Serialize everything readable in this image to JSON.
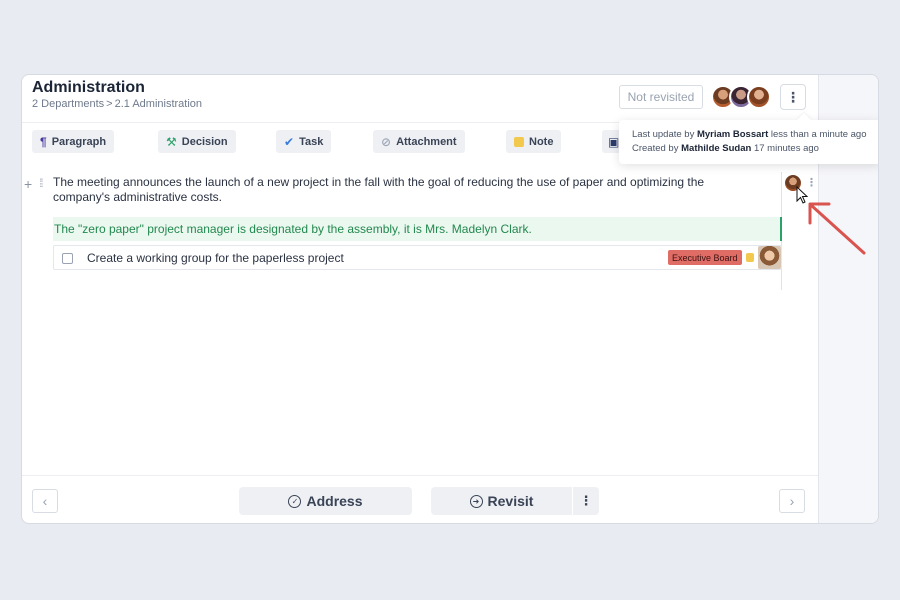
{
  "header": {
    "title": "Administration",
    "breadcrumb": {
      "part1": "2 Departments",
      "separator": ">",
      "part2": "2.1 Administration"
    },
    "status": "Not revisited"
  },
  "toolbar": {
    "paragraph": "Paragraph",
    "decision": "Decision",
    "task": "Task",
    "attachment": "Attachment",
    "note": "Note"
  },
  "tooltip": {
    "line1_prefix": "Last update by",
    "line1_name": "Myriam Bossart",
    "line1_suffix": "less than a minute ago",
    "line2_prefix": "Created by",
    "line2_name": "Mathilde Sudan",
    "line2_suffix": "17 minutes ago"
  },
  "content": {
    "paragraph": "The meeting announces the launch of a new project in the fall with the goal of reducing the use of paper and optimizing the company's administrative costs.",
    "decision": "The \"zero paper\" project manager is designated by the assembly, it is Mrs. Madelyn Clark.",
    "task": {
      "text": "Create a working group for the paperless project",
      "badge": "Executive Board"
    }
  },
  "footer": {
    "address": "Address",
    "revisit": "Revisit"
  },
  "colors": {
    "accent_green": "#2aa06a",
    "badge_red": "#e06c66",
    "note_yellow": "#f2c94c",
    "annotation_arrow": "#d9534f"
  },
  "icons": [
    "paragraph-icon",
    "decision-icon",
    "task-check-icon",
    "attachment-icon",
    "note-icon",
    "image-icon",
    "kebab-icon",
    "plus-icon",
    "drag-handle-icon",
    "chevron-left-icon",
    "chevron-right-icon",
    "check-circle-icon",
    "arrow-circle-icon"
  ]
}
